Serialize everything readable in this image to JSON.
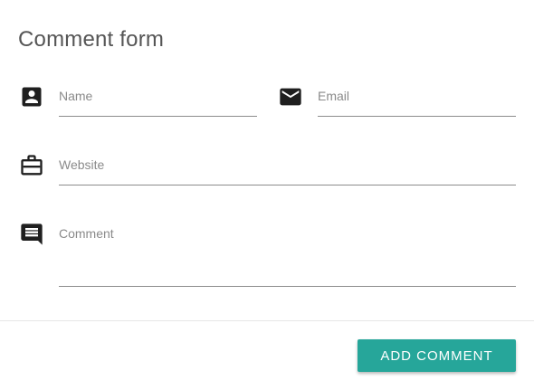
{
  "form": {
    "title": "Comment form",
    "fields": {
      "name": {
        "label": "Name",
        "icon": "account-box-icon"
      },
      "email": {
        "label": "Email",
        "icon": "mail-icon"
      },
      "website": {
        "label": "Website",
        "icon": "work-briefcase-icon"
      },
      "comment": {
        "label": "Comment",
        "icon": "comment-icon"
      }
    },
    "submit_label": "ADD COMMENT"
  },
  "colors": {
    "accent": "#26a69a",
    "icon": "#1f1f1f",
    "label": "#8a8a8a",
    "title": "#555555"
  }
}
